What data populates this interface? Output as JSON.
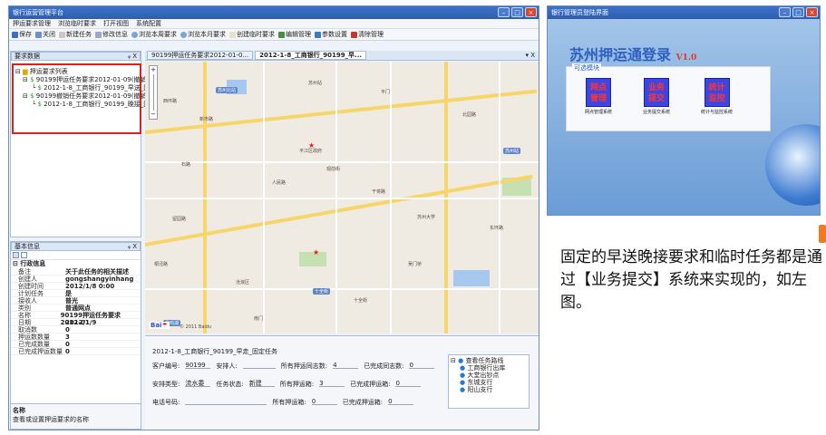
{
  "main": {
    "title": "银行运营管理平台",
    "menu": [
      "押运要求管理",
      "浏览临时要求",
      "打开视图",
      "系统配置"
    ],
    "toolbar": [
      "保存",
      "关闭",
      "新建任务",
      "修改信息",
      "浏览本周要求",
      "浏览本月要求",
      "创建临时要求",
      "编辑管理",
      "参数设置",
      "清除管理"
    ],
    "left_pane_title": "要求数据",
    "tree": {
      "root": "押运要求列表",
      "items": [
        "90199押运任务要求2012-01-09(撤销)",
        "2012-1-8_工商银行_90199_早送_固定任务",
        "90199撤销任务要求2012-01-09(撤销)",
        "2012-1-8_工商银行_90199_晚接_固定任务"
      ]
    },
    "props_title": "基本信息",
    "props_section": "行政信息",
    "props": [
      {
        "k": "备注",
        "v": "关于此任务的相关描述"
      },
      {
        "k": "创建人",
        "v": "gongshangyinhang"
      },
      {
        "k": "创建时间",
        "v": "2012/1/8 0:00"
      },
      {
        "k": "计划任务",
        "v": "是"
      },
      {
        "k": "接收人",
        "v": "普光"
      },
      {
        "k": "类别",
        "v": "普通网点"
      },
      {
        "k": "名称",
        "v": "90199押运任务要求2012-01"
      },
      {
        "k": "日期",
        "v": "2012/1/9"
      },
      {
        "k": "取消数",
        "v": "0"
      },
      {
        "k": "押运数数量",
        "v": "3"
      },
      {
        "k": "已完成数量",
        "v": "0"
      },
      {
        "k": "已完成押运数量",
        "v": "0"
      }
    ],
    "desc_label": "名称",
    "desc_text": "查看或设置押运要求的名称",
    "tabs": [
      "90199押运任务要求2012-01-0...",
      "2012-1-8_工商银行_90199_早..."
    ],
    "tab_close": "▾ X",
    "map_labels": [
      "西环路",
      "平江区政府",
      "苏州大学",
      "人民路",
      "干将路",
      "石路",
      "观前街",
      "苏州站",
      "沧浪区",
      "十全街",
      "南门",
      "平门",
      "北园路",
      "留园路",
      "桐泾路",
      "东环路",
      "新市路",
      "吴门桥"
    ],
    "map_badges": [
      "苏州北站",
      "苏州站",
      "十全街",
      "金鸡湖"
    ],
    "map_copyright": "© 2011 Baidu",
    "baidu_logo": "Bai",
    "detail": {
      "heading": "2012-1-8_工商银行_90199_早走_固定任务",
      "fields": [
        {
          "k": "客户编号:",
          "v": "90199"
        },
        {
          "k": "安排人:",
          "v": ""
        },
        {
          "k": "所有押运同志数:",
          "v": "4"
        },
        {
          "k": "已完成同志数:",
          "v": "0"
        },
        {
          "k": "安排类型:",
          "v": "流水委"
        },
        {
          "k": "任务状态:",
          "v": "新建"
        },
        {
          "k": "所有押运箱:",
          "v": "3"
        },
        {
          "k": "已完成押运箱:",
          "v": "0"
        },
        {
          "k": "电话号码:",
          "v": ""
        },
        {
          "k": "所有押运箱:",
          "v": "0"
        },
        {
          "k": "已完成押运箱:",
          "v": "0"
        }
      ],
      "route_title": "查看任务路线",
      "route_items": [
        "工商银行出库",
        "大堂出钞点",
        "东城支行",
        "阳山支行"
      ]
    }
  },
  "login": {
    "title": "银行管理员登陆界面",
    "heading": "苏州押运通登录",
    "version": "V1.0",
    "group_label": "可选模块",
    "buttons": [
      {
        "label": "网点管理",
        "caption": "网点管理系统"
      },
      {
        "label": "业务提交",
        "caption": "业务提交系统"
      },
      {
        "label": "统计监控",
        "caption": "统计与监控系统"
      }
    ]
  },
  "note": "固定的早送晚接要求和临时任务都是通过【业务提交】系统来实现的，如左图。",
  "colors": {
    "accent": "#2c5db0",
    "highlight": "#e02020",
    "gradient_top": "#a6c7e9"
  }
}
